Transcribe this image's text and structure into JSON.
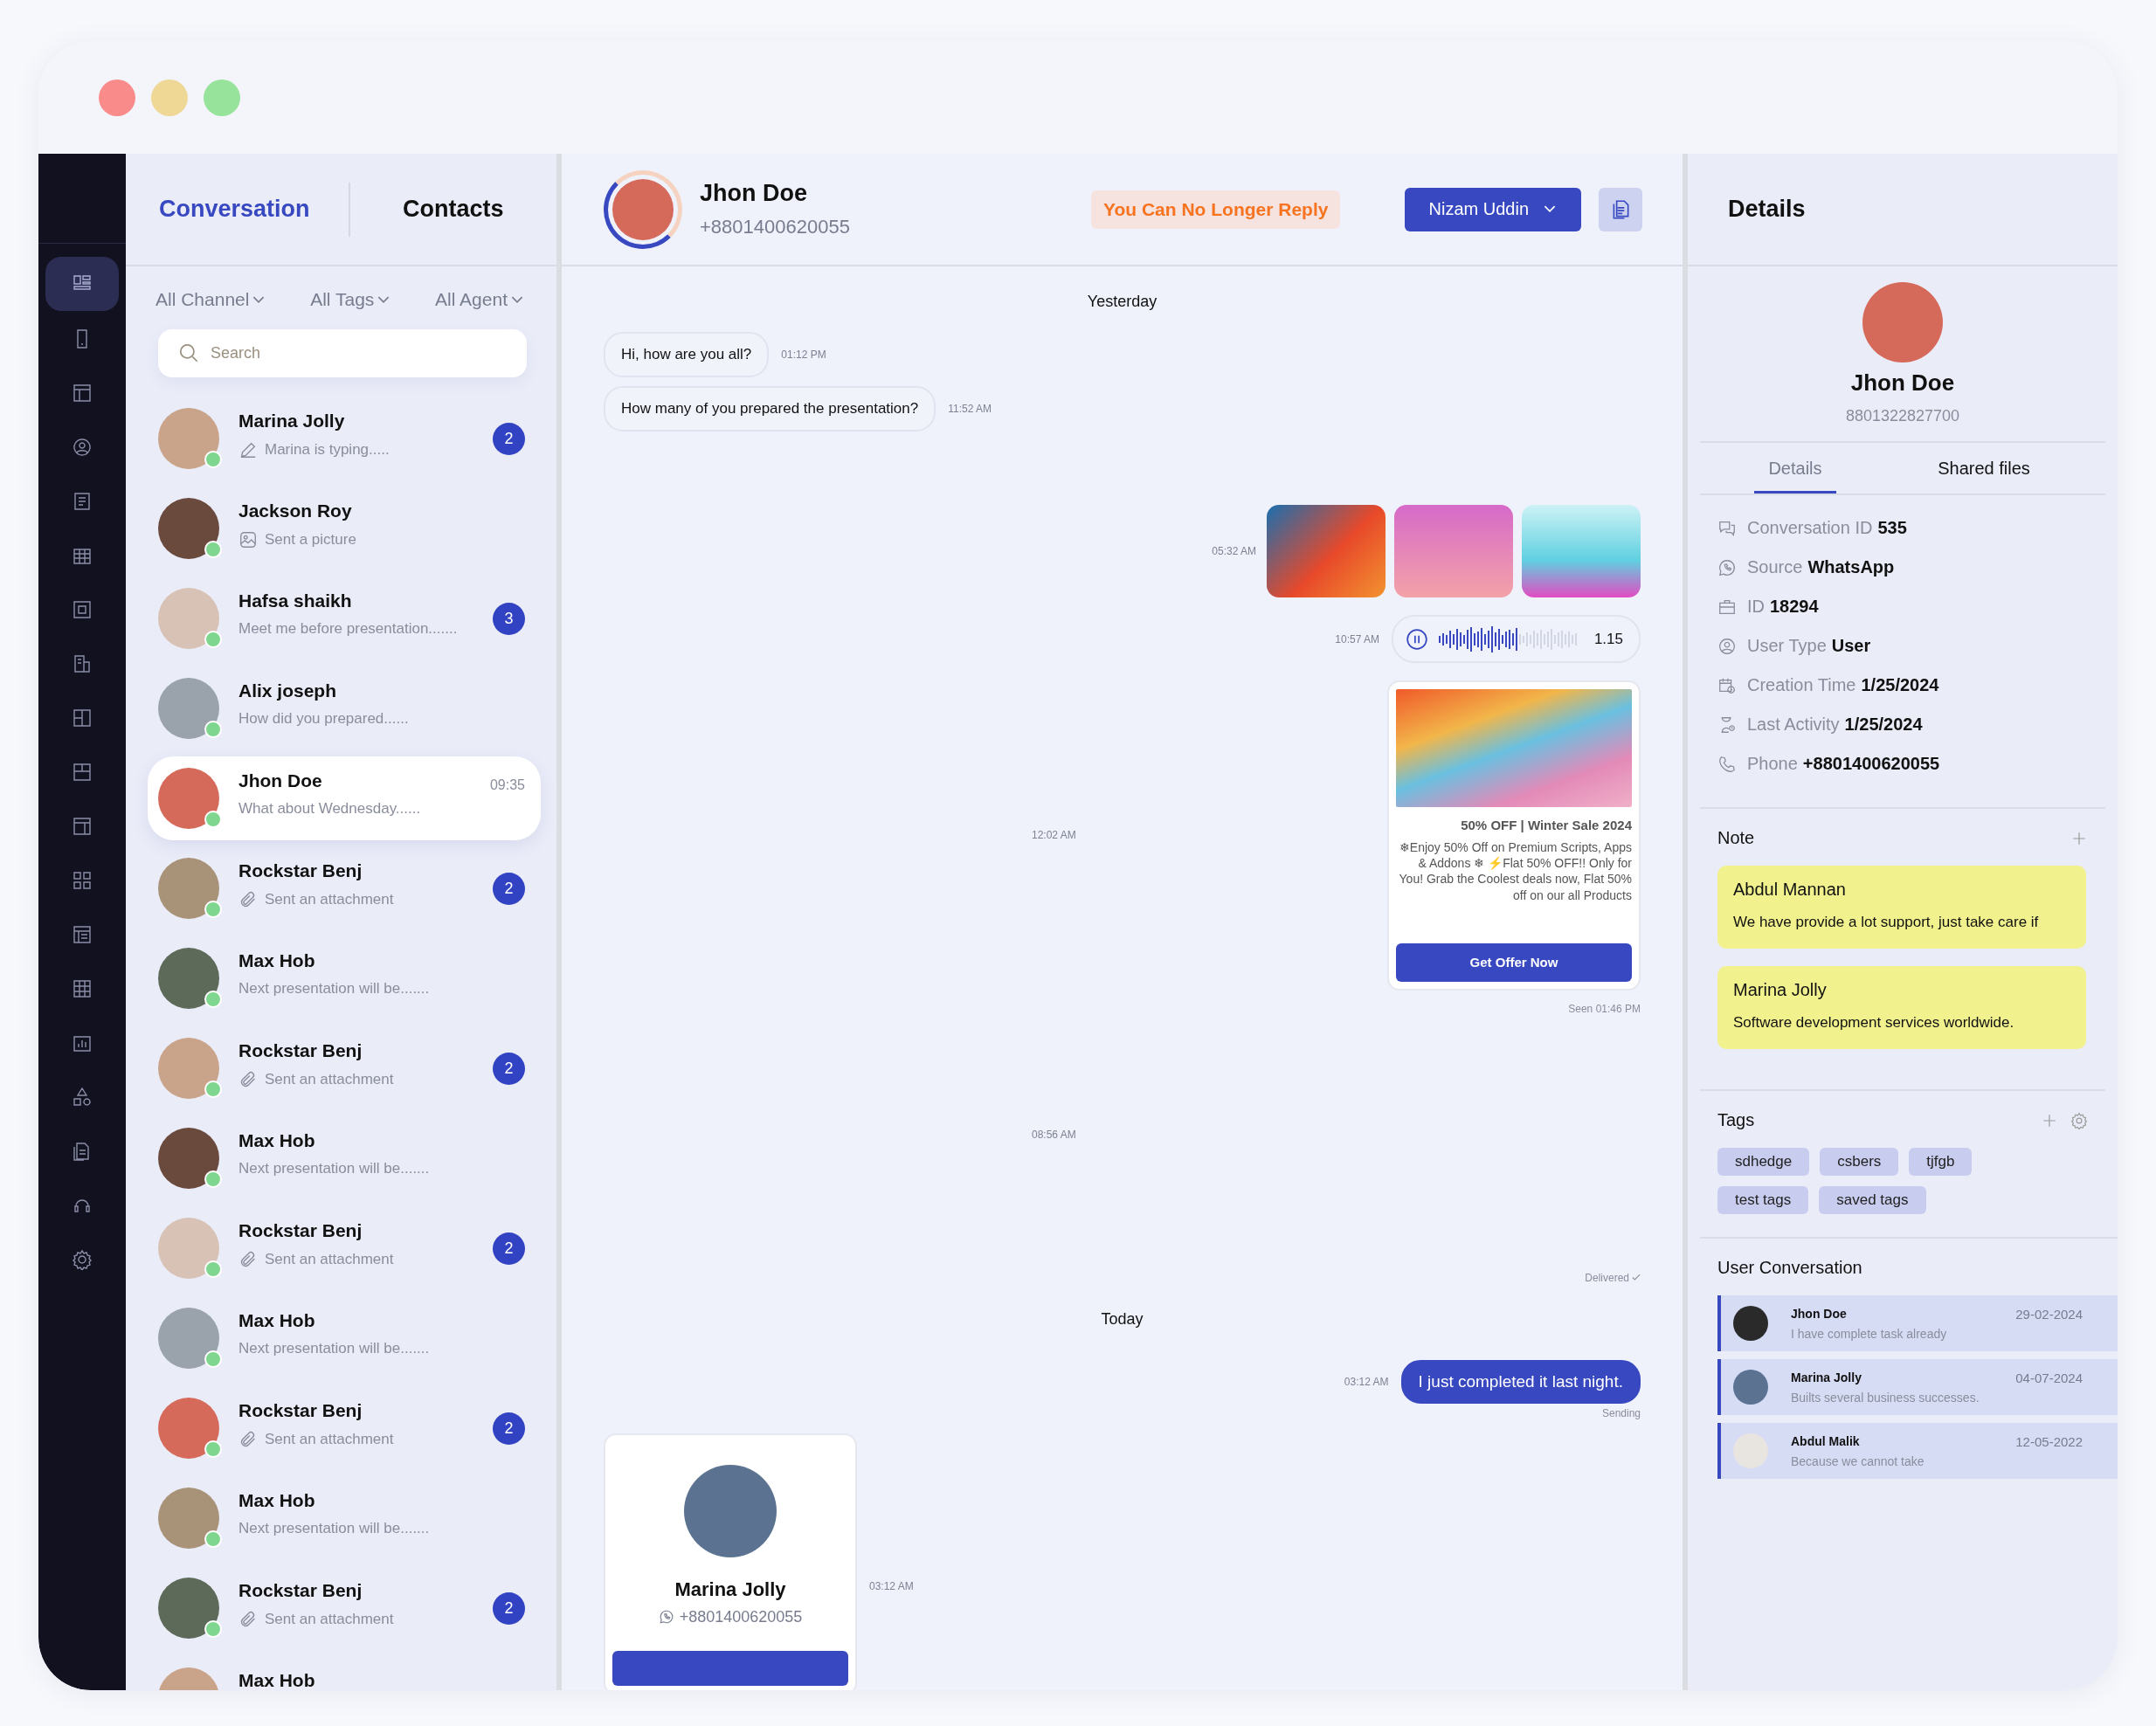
{
  "window": {
    "controls": [
      {
        "kind": "close"
      },
      {
        "kind": "minimize"
      },
      {
        "kind": "maximize"
      }
    ]
  },
  "nav": [
    {
      "selected": true
    },
    {
      "selected": false
    },
    {
      "selected": false
    },
    {
      "selected": false
    },
    {
      "selected": false
    },
    {
      "selected": false
    },
    {
      "selected": false
    },
    {
      "selected": false
    },
    {
      "selected": false
    },
    {
      "selected": false
    },
    {
      "selected": false
    },
    {
      "selected": false
    },
    {
      "selected": false
    },
    {
      "selected": false
    },
    {
      "selected": false
    },
    {
      "selected": false
    },
    {
      "selected": false
    },
    {
      "selected": false
    },
    {
      "selected": false
    }
  ],
  "list_tabs": [
    {
      "label": "Conversation",
      "selected": true
    },
    {
      "label": "Contacts",
      "selected": false
    }
  ],
  "filters": [
    "All Channel",
    "All Tags",
    "All Agent"
  ],
  "search": {
    "placeholder": "Search"
  },
  "conversations": [
    {
      "name": "Marina Jolly",
      "kind": "typing",
      "preview": "Marina is typing.....",
      "badge": "2",
      "online": true,
      "selected": false
    },
    {
      "name": "Jackson Roy",
      "kind": "picture",
      "preview": "Sent a picture",
      "online": true,
      "selected": false
    },
    {
      "name": "Hafsa shaikh",
      "kind": "text",
      "preview": "Meet me before presentation.......",
      "badge": "3",
      "online": true,
      "selected": false
    },
    {
      "name": "Alix joseph",
      "kind": "text",
      "preview": "How did you prepared......",
      "online": true,
      "selected": false
    },
    {
      "name": "Jhon Doe",
      "kind": "text",
      "preview": "What about Wednesday......",
      "time": "09:35",
      "online": true,
      "selected": true
    },
    {
      "name": "Rockstar Benj",
      "kind": "attachment",
      "preview": "Sent an attachment",
      "badge": "2",
      "online": true,
      "selected": false
    },
    {
      "name": "Max Hob",
      "kind": "text",
      "preview": "Next presentation will be.......",
      "online": true,
      "selected": false
    },
    {
      "name": "Rockstar Benj",
      "kind": "attachment",
      "preview": "Sent an attachment",
      "badge": "2",
      "online": true,
      "selected": false
    },
    {
      "name": "Max Hob",
      "kind": "text",
      "preview": "Next presentation will be.......",
      "online": true,
      "selected": false
    },
    {
      "name": "Rockstar Benj",
      "kind": "attachment",
      "preview": "Sent an attachment",
      "badge": "2",
      "online": true,
      "selected": false
    },
    {
      "name": "Max Hob",
      "kind": "text",
      "preview": "Next presentation will be.......",
      "online": true,
      "selected": false
    },
    {
      "name": "Rockstar Benj",
      "kind": "attachment",
      "preview": "Sent an attachment",
      "badge": "2",
      "online": true,
      "selected": false
    },
    {
      "name": "Max Hob",
      "kind": "text",
      "preview": "Next presentation will be.......",
      "online": true,
      "selected": false
    },
    {
      "name": "Rockstar Benj",
      "kind": "attachment",
      "preview": "Sent an attachment",
      "badge": "2",
      "online": true,
      "selected": false
    },
    {
      "name": "Max Hob",
      "selected": false
    }
  ],
  "chat_header": {
    "name": "Jhon Doe",
    "phone": "+8801400620055",
    "notice": "You Can No Longer Reply",
    "agent": "Nizam Uddin"
  },
  "messages": [
    {
      "kind": "date",
      "text": "Yesterday"
    },
    {
      "kind": "incoming",
      "text": "Hi, how are you all?",
      "time": "01:12 PM"
    },
    {
      "kind": "incoming",
      "text": "How many of you prepared the presentation?",
      "time": "11:52 AM"
    },
    {
      "kind": "images",
      "time": "05:32 AM"
    },
    {
      "kind": "voice",
      "time": "10:57 AM",
      "duration": "1.15",
      "level": 0.55
    },
    {
      "kind": "offer",
      "time": "12:02 AM",
      "title": "50% OFF | Winter Sale 2024",
      "body": "❄Enjoy 50% Off on Premium Scripts, Apps & Addons ❄ ⚡Flat 50% OFF!! Only for You! Grab the Coolest deals now, Flat 50% off on our all Products",
      "button": "Get Offer Now",
      "status": "Seen 01:46 PM"
    },
    {
      "kind": "time",
      "time": "08:56 AM"
    },
    {
      "kind": "status",
      "text": "Delivered"
    },
    {
      "kind": "date",
      "text": "Today"
    },
    {
      "kind": "outgoing",
      "text": "I just completed it last night.",
      "time": "03:12 AM",
      "status": "Sending"
    },
    {
      "kind": "contact",
      "name": "Marina Jolly",
      "phone": "+8801400620055",
      "time": "03:12 AM"
    }
  ],
  "details": {
    "title": "Details",
    "name": "Jhon Doe",
    "phone": "8801322827700",
    "tabs": [
      {
        "label": "Details",
        "selected": true
      },
      {
        "label": "Shared files",
        "selected": false
      }
    ],
    "fields": [
      {
        "label": "Conversation ID",
        "value": "535"
      },
      {
        "label": "Source",
        "value": "WhatsApp"
      },
      {
        "label": "ID",
        "value": "18294"
      },
      {
        "label": "User Type",
        "value": "User"
      },
      {
        "label": "Creation Time",
        "value": "1/25/2024"
      },
      {
        "label": "Last Activity",
        "value": "1/25/2024"
      },
      {
        "label": "Phone",
        "value": "+8801400620055"
      }
    ],
    "note_title": "Note",
    "notes": [
      {
        "author": "Abdul Mannan",
        "text": "We have provide a lot support, just take care if"
      },
      {
        "author": "Marina Jolly",
        "text": "Software development services worldwide."
      }
    ],
    "tags_title": "Tags",
    "tags": [
      "sdhedge",
      "csbers",
      "tjfgb",
      "test tags",
      "saved tags"
    ],
    "user_conversation_title": "User Conversation",
    "user_conversations": [
      {
        "name": "Jhon Doe",
        "date": "29-02-2024",
        "text": "I have complete task already"
      },
      {
        "name": "Marina Jolly",
        "date": "04-07-2024",
        "text": "Builts several business successes."
      },
      {
        "name": "Abdul Malik",
        "date": "12-05-2022",
        "text": "Because we cannot take"
      }
    ]
  }
}
